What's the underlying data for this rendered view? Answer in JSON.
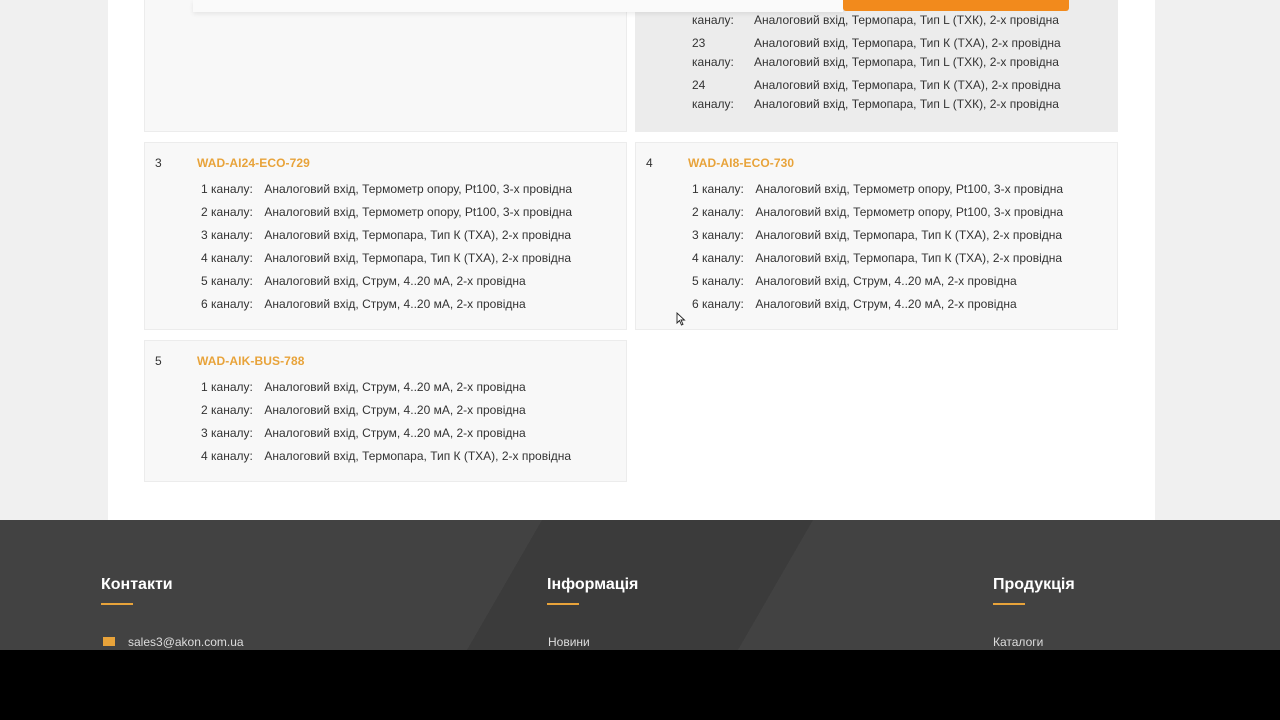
{
  "top_card": {
    "rows": [
      {
        "line1_num": "",
        "line1_val": "",
        "line2_label": "каналу:",
        "line2_val": "Аналоговий вхід, Термопара, Тип L (ТХК), 2-х провідна"
      },
      {
        "line1_num": "23",
        "line1_val": "Аналоговий вхід, Термопара, Тип К (ТХА), 2-х провідна",
        "line2_label": "каналу:",
        "line2_val": "Аналоговий вхід, Термопара, Тип L (ТХК), 2-х провідна"
      },
      {
        "line1_num": "24",
        "line1_val": "Аналоговий вхід, Термопара, Тип К (ТХА), 2-х провідна",
        "line2_label": "каналу:",
        "line2_val": "Аналоговий вхід, Термопара, Тип L (ТХК), 2-х провідна"
      }
    ]
  },
  "cards": [
    {
      "num": "3",
      "title": "WAD-AI24-ECO-729",
      "rows": [
        {
          "label": "1 каналу:",
          "value": "Аналоговий вхід, Термометр опору, Pt100, 3-х провідна"
        },
        {
          "label": "2 каналу:",
          "value": "Аналоговий вхід, Термометр опору, Pt100, 3-х провідна"
        },
        {
          "label": "3 каналу:",
          "value": "Аналоговий вхід, Термопара, Тип К (ТХА), 2-х провідна"
        },
        {
          "label": "4 каналу:",
          "value": "Аналоговий вхід, Термопара, Тип К (ТХА), 2-х провідна"
        },
        {
          "label": "5 каналу:",
          "value": "Аналоговий вхід, Струм, 4..20 мА, 2-х провідна"
        },
        {
          "label": "6 каналу:",
          "value": "Аналоговий вхід, Струм, 4..20 мА, 2-х провідна"
        }
      ]
    },
    {
      "num": "4",
      "title": "WAD-AI8-ECO-730",
      "rows": [
        {
          "label": "1 каналу:",
          "value": "Аналоговий вхід, Термометр опору, Pt100, 3-х провідна"
        },
        {
          "label": "2 каналу:",
          "value": "Аналоговий вхід, Термометр опору, Pt100, 3-х провідна"
        },
        {
          "label": "3 каналу:",
          "value": "Аналоговий вхід, Термопара, Тип К (ТХА), 2-х провідна"
        },
        {
          "label": "4 каналу:",
          "value": "Аналоговий вхід, Термопара, Тип К (ТХА), 2-х провідна"
        },
        {
          "label": "5 каналу:",
          "value": "Аналоговий вхід, Струм, 4..20 мА, 2-х провідна"
        },
        {
          "label": "6 каналу:",
          "value": "Аналоговий вхід, Струм, 4..20 мА, 2-х провідна"
        }
      ]
    },
    {
      "num": "5",
      "title": "WAD-AIK-BUS-788",
      "rows": [
        {
          "label": "1 каналу:",
          "value": "Аналоговий вхід, Струм, 4..20 мА, 2-х провідна"
        },
        {
          "label": "2 каналу:",
          "value": "Аналоговий вхід, Струм, 4..20 мА, 2-х провідна"
        },
        {
          "label": "3 каналу:",
          "value": "Аналоговий вхід, Струм, 4..20 мА, 2-х провідна"
        },
        {
          "label": "4 каналу:",
          "value": "Аналоговий вхід, Термопара, Тип К (ТХА), 2-х провідна"
        }
      ]
    }
  ],
  "footer": {
    "contacts": {
      "heading": "Контакти",
      "email": "sales3@akon.com.ua"
    },
    "info": {
      "heading": "Інформація",
      "link": "Новини"
    },
    "products": {
      "heading": "Продукція",
      "link": "Каталоги"
    }
  },
  "colors": {
    "accent": "#e8a33a",
    "orange_button": "#f28a1c",
    "footer_bg": "#3e3e3e"
  }
}
